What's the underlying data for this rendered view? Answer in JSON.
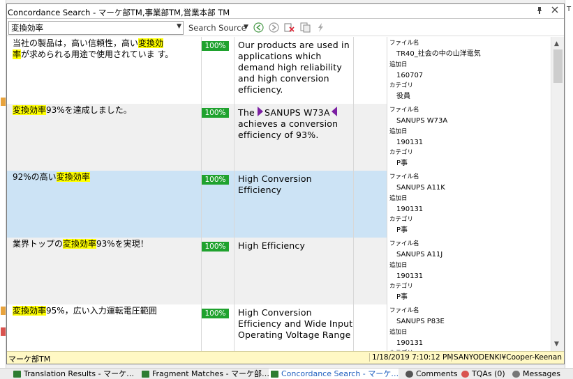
{
  "window": {
    "title": "Concordance Search - マーケ部TM,事業部TM,営業本部 TM",
    "pin_icon": "pin-icon",
    "close_icon": "close-icon"
  },
  "right_strip": {
    "text": "T"
  },
  "toolbar": {
    "search_value": "変換効率",
    "search_placeholder": "",
    "search_mode_label": "Search Source",
    "icons": [
      "back-icon",
      "forward-icon",
      "clear-icon",
      "copy-icon",
      "lightning-icon"
    ]
  },
  "results": [
    {
      "source_parts": [
        {
          "t": "当社の製品は，高い信頼性，高い",
          "h": false
        },
        {
          "t": "変換効",
          "h": true
        },
        {
          "t": "\n",
          "h": false
        },
        {
          "t": "率",
          "h": true
        },
        {
          "t": "が求められる用途で使用されていま す。",
          "h": false
        }
      ],
      "match": "100%",
      "target": "Our products are used in applications which demand high reliability and high conversion efficiency.",
      "target_tagged": null,
      "meta": [
        {
          "key": "ファイル名",
          "value": "TR40_社会の中の山洋電気"
        },
        {
          "key": "追加日",
          "value": "160707"
        },
        {
          "key": "カテゴリ",
          "value": "役員"
        }
      ],
      "style": "white"
    },
    {
      "source_parts": [
        {
          "t": "変換効率",
          "h": true
        },
        {
          "t": "93%を達成しました。",
          "h": false
        }
      ],
      "match": "100%",
      "target": "",
      "target_tagged": {
        "before": "The ",
        "tag_text": "SANUPS W73A",
        "after": " achieves a conversion efficiency of 93%."
      },
      "meta": [
        {
          "key": "ファイル名",
          "value": "SANUPS W73A"
        },
        {
          "key": "追加日",
          "value": "190131"
        },
        {
          "key": "カテゴリ",
          "value": "P事"
        }
      ],
      "style": "alt"
    },
    {
      "source_parts": [
        {
          "t": "92%の高い",
          "h": false
        },
        {
          "t": "変換効率",
          "h": true
        }
      ],
      "match": "100%",
      "target": "High Conversion Efficiency",
      "target_tagged": null,
      "meta": [
        {
          "key": "ファイル名",
          "value": "SANUPS A11K"
        },
        {
          "key": "追加日",
          "value": "190131"
        },
        {
          "key": "カテゴリ",
          "value": "P事"
        }
      ],
      "style": "selected"
    },
    {
      "source_parts": [
        {
          "t": "業界トップの",
          "h": false
        },
        {
          "t": "変換効率",
          "h": true
        },
        {
          "t": "93%を実現！",
          "h": false
        }
      ],
      "match": "100%",
      "target": "High Efficiency",
      "target_tagged": null,
      "meta": [
        {
          "key": "ファイル名",
          "value": "SANUPS A11J"
        },
        {
          "key": "追加日",
          "value": "190131"
        },
        {
          "key": "カテゴリ",
          "value": "P事"
        }
      ],
      "style": "alt"
    },
    {
      "source_parts": [
        {
          "t": "変換効率",
          "h": true
        },
        {
          "t": "95%，広い入力運転電圧範囲",
          "h": false
        }
      ],
      "match": "100%",
      "target": "High Conversion Efficiency and Wide Input Operating Voltage Range",
      "target_tagged": null,
      "meta": [
        {
          "key": "ファイル名",
          "value": "SANUPS P83E"
        },
        {
          "key": "追加日",
          "value": "190131"
        },
        {
          "key": "カテゴリ",
          "value": ""
        }
      ],
      "style": "white"
    }
  ],
  "status": {
    "tm_name": "マーケ部TM",
    "timestamp": "1/18/2019 7:10:12 PM",
    "user": "SANYODENKI¥Cooper-Keenan"
  },
  "tabs": [
    {
      "label": "Translation Results - マーケ…",
      "icon": "translation-results-icon",
      "active": false
    },
    {
      "label": "Fragment Matches - マーケ部…",
      "icon": "fragment-matches-icon",
      "active": false
    },
    {
      "label": "Concordance Search - マーケ…",
      "icon": "concordance-search-icon",
      "active": true
    },
    {
      "label": "Comments",
      "icon": "comments-icon",
      "active": false
    },
    {
      "label": "TQAs (0)",
      "icon": "tqa-icon",
      "active": false
    },
    {
      "label": "Messages",
      "icon": "messages-icon",
      "active": false
    }
  ],
  "colors": {
    "highlight": "#ffff00",
    "match_badge": "#1fa22e",
    "selected_row": "#cce3f5",
    "alt_row": "#f0f0f0",
    "tag": "#7b1fa2",
    "status_bar": "#fff8c4",
    "active_tab_text": "#1f5fbf"
  }
}
